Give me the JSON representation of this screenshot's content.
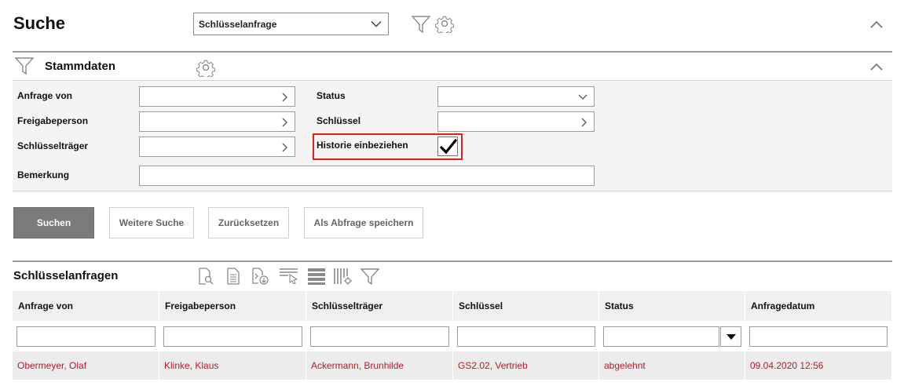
{
  "header": {
    "title": "Suche",
    "query_select_value": "Schlüsselanfrage"
  },
  "stammdaten": {
    "title": "Stammdaten",
    "labels": {
      "anfrage_von": "Anfrage von",
      "freigabeperson": "Freigabeperson",
      "schluesseltraeger": "Schlüsselträger",
      "bemerkung": "Bemerkung",
      "status": "Status",
      "schluessel": "Schlüssel",
      "historie": "Historie einbeziehen"
    },
    "historie_checked": true
  },
  "buttons": {
    "suchen": "Suchen",
    "weitere_suche": "Weitere Suche",
    "zuruecksetzen": "Zurücksetzen",
    "abfrage_speichern": "Als Abfrage speichern"
  },
  "results": {
    "title": "Schlüsselanfragen",
    "columns": [
      "Anfrage von",
      "Freigabeperson",
      "Schlüsselträger",
      "Schlüssel",
      "Status",
      "Anfragedatum"
    ],
    "rows": [
      [
        "Obermeyer, Olaf",
        "Klinke, Klaus",
        "Ackermann, Brunhilde",
        "GS2.02, Vertrieb",
        "abgelehnt",
        "09.04.2020 12:56"
      ]
    ]
  },
  "colors": {
    "row_text": "#b0202a",
    "highlight_border": "#e02020",
    "primary_button": "#7b7b7b"
  }
}
